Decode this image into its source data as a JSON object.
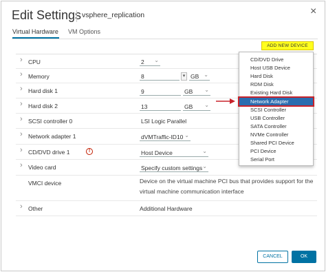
{
  "dialog": {
    "title": "Edit Settings",
    "vm_name": "vsphere_replication",
    "close_glyph": "×"
  },
  "tabs": [
    {
      "label": "Virtual Hardware"
    },
    {
      "label": "VM Options"
    }
  ],
  "add_button": "ADD NEW DEVICE",
  "rows": {
    "cpu": {
      "label": "CPU",
      "value": "2"
    },
    "memory": {
      "label": "Memory",
      "value": "8",
      "unit": "GB"
    },
    "hd1": {
      "label": "Hard disk 1",
      "value": "9",
      "unit": "GB"
    },
    "hd2": {
      "label": "Hard disk 2",
      "value": "13",
      "unit": "GB"
    },
    "scsi": {
      "label": "SCSI controller 0",
      "value": "LSI Logic Parallel"
    },
    "net": {
      "label": "Network adapter 1",
      "value": "dVMTraffic-ID10"
    },
    "cd": {
      "label": "CD/DVD drive 1",
      "value": "Host Device"
    },
    "video": {
      "label": "Video card",
      "value": "Specify custom settings"
    },
    "vmci": {
      "label": "VMCI device",
      "line1": "Device on the virtual machine PCI bus that provides support for the",
      "line2": "virtual machine communication interface"
    },
    "other": {
      "label": "Other",
      "value": "Additional Hardware"
    }
  },
  "menu_items": [
    "CD/DVD Drive",
    "Host USB Device",
    "Hard Disk",
    "RDM Disk",
    "Existing Hard Disk",
    "Network Adapter",
    "SCSI Controller",
    "USB Controller",
    "SATA Controller",
    "NVMe Controller",
    "Shared PCI Device",
    "PCI Device",
    "Serial Port"
  ],
  "selected_menu_item": "Network Adapter",
  "footer": {
    "cancel": "CANCEL",
    "ok": "OK"
  },
  "colors": {
    "accent": "#0072a3",
    "highlight_button": "#ffff1e",
    "selection": "#2a6db0",
    "annotation_red": "#c8222a"
  },
  "icons": {
    "expand": "chevron-right-icon",
    "dropdown": "chevron-down-icon",
    "warning": "warning-icon"
  }
}
